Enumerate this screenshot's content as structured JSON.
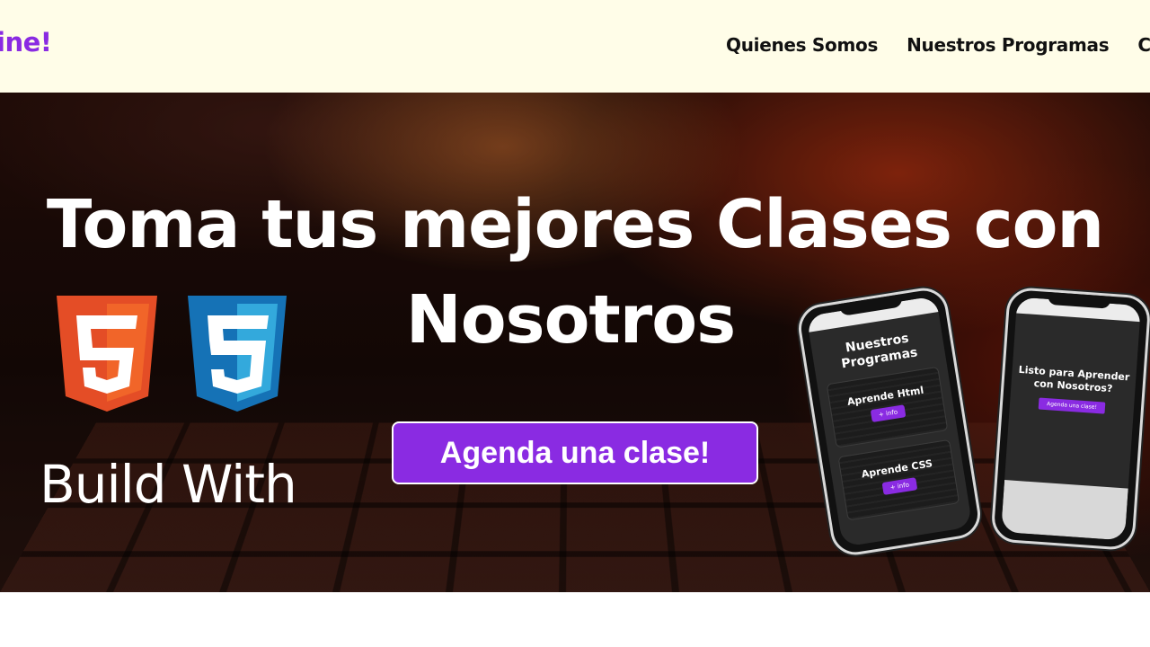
{
  "header": {
    "logo_text": "ine!",
    "nav": [
      "Quienes Somos",
      "Nuestros Programas",
      "C"
    ]
  },
  "hero": {
    "headline_line1": "Toma tus mejores Clases con",
    "headline_line2": "Nosotros",
    "cta_label": "Agenda una clase!",
    "build_with": "Build With",
    "tech_logos": [
      "html5-icon",
      "css3-icon"
    ]
  },
  "phone_left": {
    "title": "Nuestros Programas",
    "cards": [
      {
        "title": "Aprende Html",
        "button": "+ info"
      },
      {
        "title": "Aprende CSS",
        "button": "+ info"
      }
    ]
  },
  "phone_right": {
    "title": "Listo para Aprender con Nosotros?",
    "button": "Agenda una clase!"
  },
  "colors": {
    "accent": "#8a2be2",
    "header_bg": "#fffde8",
    "html5": "#e44d26",
    "css3": "#1572b6"
  }
}
